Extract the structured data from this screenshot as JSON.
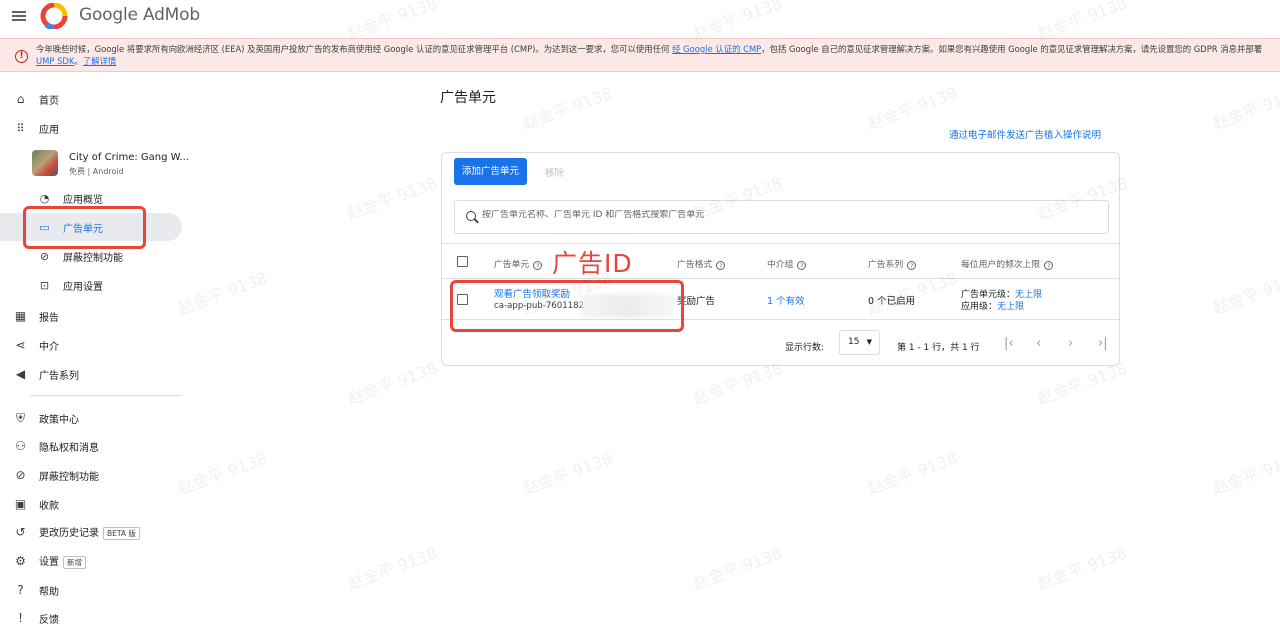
{
  "header": {
    "logo_text": "Google AdMob"
  },
  "banner": {
    "text_1": "今年晚些时候，Google 将要求所有向欧洲经济区 (EEA) 及英国用户投放广告的发布商使用经 Google 认证的意见征求管理平台 (CMP)。为达到这一要求，您可以使用任何",
    "link_1": "经 Google 认证的 CMP",
    "text_2": "，包括 Google 自己的意见征求管理解决方案。如果您有兴趣使用 Google 的意见征求管理解决方案，请先设置您的 GDPR 消息并部署",
    "link_2": "UMP SDK",
    "text_3": "。",
    "link_3": "了解详情"
  },
  "sidebar": {
    "home": "首页",
    "apps": "应用",
    "app": {
      "name": "City of Crime: Gang W...",
      "meta": "免费 | Android"
    },
    "app_overview": "应用概览",
    "ad_units": "广告单元",
    "blocking_controls": "屏蔽控制功能",
    "app_settings": "应用设置",
    "reports": "报告",
    "mediation": "中介",
    "campaigns": "广告系列",
    "policy_center": "政策中心",
    "privacy_messaging": "隐私权和消息",
    "blocking_controls_2": "屏蔽控制功能",
    "payments": "收款",
    "change_history": "更改历史记录",
    "beta_badge": "BETA 版",
    "settings": "设置",
    "new_badge": "新增",
    "help": "帮助",
    "feedback": "反馈"
  },
  "main": {
    "title": "广告单元",
    "email_link": "通过电子邮件发送广告植入操作说明",
    "add_button": "添加广告单元",
    "remove_button": "移除",
    "search_placeholder": "按广告单元名称、广告单元 ID 和广告格式搜索广告单元",
    "columns": {
      "ad_unit": "广告单元",
      "format": "广告格式",
      "mediation_group": "中介组",
      "campaigns": "广告系列",
      "frequency_cap": "每位用户的频次上限"
    },
    "rows": [
      {
        "name": "观看广告领取奖励",
        "id": "ca-app-pub-76011820",
        "format": "奖励广告",
        "mediation": "1 个有效",
        "campaigns": "0 个已启用",
        "freq_unit_label": "广告单元级：",
        "freq_unit_value": "无上限",
        "freq_app_label": "应用级：",
        "freq_app_value": "无上限"
      }
    ],
    "footer": {
      "rows_label": "显示行数:",
      "rows_value": "15",
      "range": "第 1 - 1 行，共 1 行"
    }
  },
  "annotation": {
    "label": "广告ID"
  },
  "watermark": "赵金平 9138",
  "colors": {
    "accent": "#1a73e8",
    "annotation_red": "#e8453c",
    "banner_bg": "#fce8e6"
  }
}
